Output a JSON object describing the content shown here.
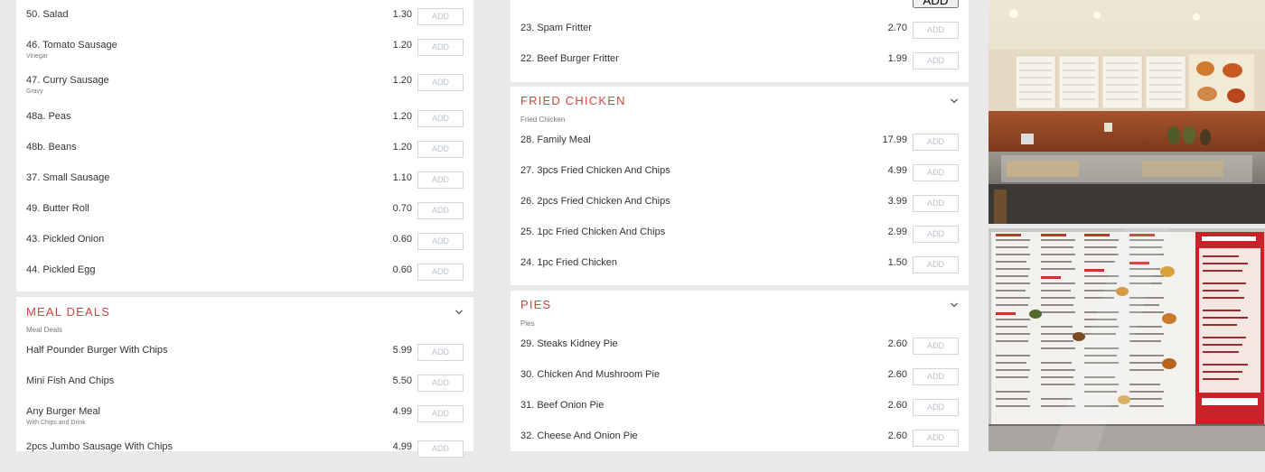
{
  "ui": {
    "add_label": "ADD"
  },
  "column1": {
    "top_items": [
      {
        "name": "50. Salad",
        "desc": "",
        "price": "1.30"
      },
      {
        "name": "46. Tomato Sausage",
        "desc": "Vinegar",
        "price": "1.20"
      },
      {
        "name": "47. Curry Sausage",
        "desc": "Gravy",
        "price": "1.20"
      },
      {
        "name": "48a. Peas",
        "desc": "",
        "price": "1.20"
      },
      {
        "name": "48b. Beans",
        "desc": "",
        "price": "1.20"
      },
      {
        "name": "37. Small Sausage",
        "desc": "",
        "price": "1.10"
      },
      {
        "name": "49. Butter Roll",
        "desc": "",
        "price": "0.70"
      },
      {
        "name": "43. Pickled Onion",
        "desc": "",
        "price": "0.60"
      },
      {
        "name": "44. Pickled Egg",
        "desc": "",
        "price": "0.60"
      }
    ],
    "meal_deals": {
      "title": "Meal Deals",
      "subtitle": "Meal Deals",
      "items": [
        {
          "name": "Half Pounder Burger With Chips",
          "desc": "",
          "price": "5.99"
        },
        {
          "name": "Mini Fish And Chips",
          "desc": "",
          "price": "5.50"
        },
        {
          "name": "Any Burger Meal",
          "desc": "With Chips and Drink",
          "price": "4.99"
        },
        {
          "name": "2pcs Jumbo Sausage With Chips",
          "desc": "",
          "price": "4.99"
        }
      ]
    }
  },
  "column2": {
    "top_items": [
      {
        "name": "23. Spam Fritter",
        "desc": "",
        "price": "2.70"
      },
      {
        "name": "22. Beef Burger Fritter",
        "desc": "",
        "price": "1.99"
      }
    ],
    "fried_chicken": {
      "title": "Fried Chicken",
      "subtitle": "Fried Chicken",
      "items": [
        {
          "name": "28. Family Meal",
          "desc": "",
          "price": "17.99"
        },
        {
          "name": "27. 3pcs Fried Chicken And Chips",
          "desc": "",
          "price": "4.99"
        },
        {
          "name": "26. 2pcs Fried Chicken And Chips",
          "desc": "",
          "price": "3.99"
        },
        {
          "name": "25. 1pc Fried Chicken And Chips",
          "desc": "",
          "price": "2.99"
        },
        {
          "name": "24. 1pc Fried Chicken",
          "desc": "",
          "price": "1.50"
        }
      ]
    },
    "pies": {
      "title": "Pies",
      "subtitle": "Pies",
      "items": [
        {
          "name": "29. Steaks Kidney Pie",
          "desc": "",
          "price": "2.60"
        },
        {
          "name": "30. Chicken And Mushroom Pie",
          "desc": "",
          "price": "2.60"
        },
        {
          "name": "31. Beef Onion Pie",
          "desc": "",
          "price": "2.60"
        },
        {
          "name": "32. Cheese And Onion Pie",
          "desc": "",
          "price": "2.60"
        }
      ]
    }
  },
  "photos": [
    {
      "label": "restaurant-counter-photo"
    },
    {
      "label": "menu-board-photo"
    }
  ],
  "colors": {
    "accent": "#d2453f",
    "page_bg": "#e9e9e9",
    "card_bg": "#ffffff"
  }
}
